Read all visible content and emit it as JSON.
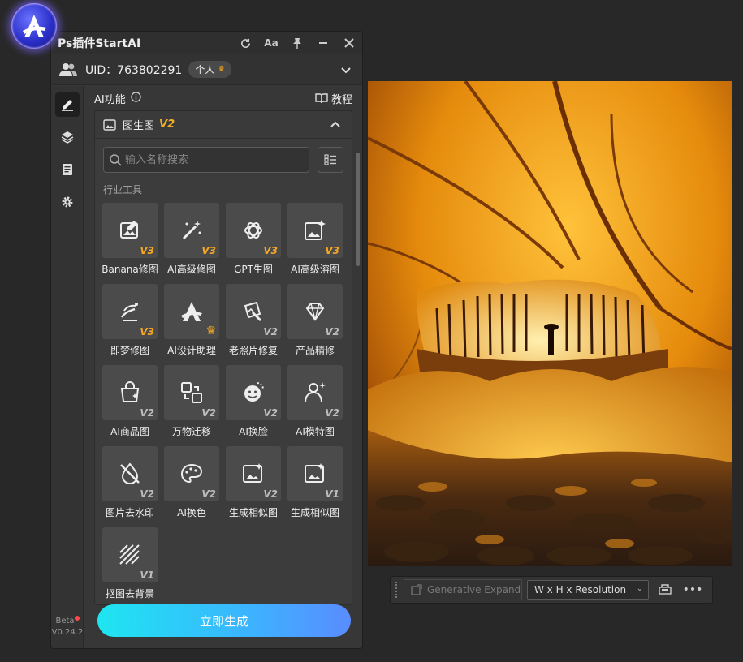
{
  "panel": {
    "title": "Ps插件StartAI",
    "uid_label": "UID：763802291",
    "user_type": "个人",
    "version_label": "Beta",
    "version": "V0.24.2"
  },
  "section": {
    "title": "AI功能",
    "tutorial": "教程"
  },
  "dropdown": {
    "title": "图生图",
    "version": "V2"
  },
  "search": {
    "placeholder": "输入名称搜索",
    "value": ""
  },
  "category": "行业工具",
  "tools": [
    {
      "name": "Banana修图",
      "badge": "V3",
      "icon": "image-edit-icon"
    },
    {
      "name": "AI高级修图",
      "badge": "V3",
      "icon": "magic-wand-icon"
    },
    {
      "name": "GPT生图",
      "badge": "V3",
      "icon": "gpt-logo-icon"
    },
    {
      "name": "AI高级溶图",
      "badge": "V3",
      "icon": "image-sparkle-icon"
    },
    {
      "name": "即梦修图",
      "badge": "V3",
      "icon": "dream-brush-icon"
    },
    {
      "name": "AI设计助理",
      "badge": "crown",
      "icon": "startai-logo-icon"
    },
    {
      "name": "老照片修复",
      "badge": "V2",
      "icon": "photo-restore-icon"
    },
    {
      "name": "产品精修",
      "badge": "V2",
      "icon": "diamond-icon"
    },
    {
      "name": "AI商品图",
      "badge": "V2",
      "icon": "shopping-bag-icon"
    },
    {
      "name": "万物迁移",
      "badge": "V2",
      "icon": "transfer-icon"
    },
    {
      "name": "AI换脸",
      "badge": "V2",
      "icon": "face-swap-icon"
    },
    {
      "name": "AI模特图",
      "badge": "V2",
      "icon": "model-icon"
    },
    {
      "name": "图片去水印",
      "badge": "V2",
      "icon": "watermark-remove-icon"
    },
    {
      "name": "AI换色",
      "badge": "V2",
      "icon": "palette-icon"
    },
    {
      "name": "生成相似图",
      "badge": "V2",
      "icon": "similar-image-icon"
    },
    {
      "name": "生成相似图",
      "badge": "V1",
      "icon": "similar-image-icon"
    },
    {
      "name": "抠图去背景",
      "badge": "V1",
      "icon": "cutout-icon"
    }
  ],
  "generate_button": "立即生成",
  "context_bar": {
    "generative_expand": "Generative Expand",
    "resolution_select": "W x H x Resolution"
  },
  "colors": {
    "accent_gold": "#f5a623",
    "button_gradient_start": "#1ee6f0",
    "button_gradient_end": "#5a8cff"
  }
}
